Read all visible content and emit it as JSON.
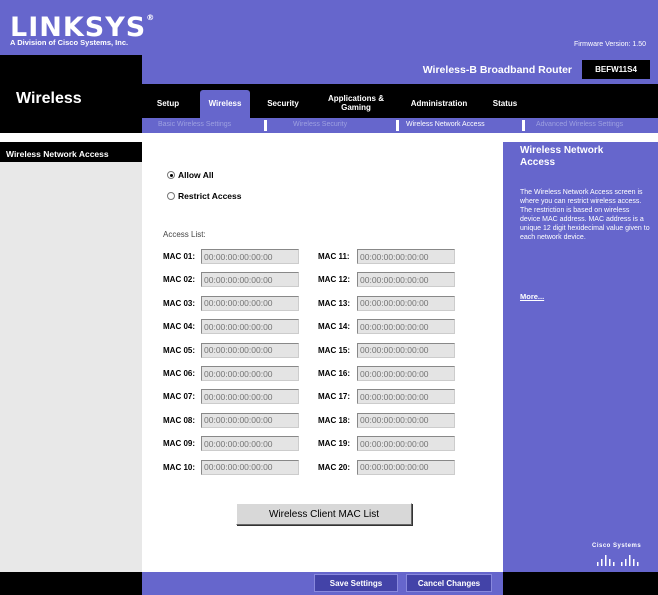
{
  "header": {
    "brand": "LINKSYS",
    "brand_mark": "®",
    "division": "A Division of Cisco Systems, Inc.",
    "firmware": "Firmware Version: 1.50",
    "product": "Wireless-B Broadband Router",
    "model": "BEFW11S4",
    "section": "Wireless"
  },
  "tabs": [
    {
      "label": "Setup",
      "active": false
    },
    {
      "label": "Wireless",
      "active": true
    },
    {
      "label": "Security",
      "active": false
    },
    {
      "label": "Applications & Gaming",
      "active": false
    },
    {
      "label": "Administration",
      "active": false
    },
    {
      "label": "Status",
      "active": false
    }
  ],
  "subtabs": [
    {
      "label": "Basic Wireless Settings",
      "active": false
    },
    {
      "label": "Wireless Security",
      "active": false
    },
    {
      "label": "Wireless Network Access",
      "active": true
    },
    {
      "label": "Advanced Wireless Settings",
      "active": false
    }
  ],
  "left_panel": {
    "title": "Wireless Network Access"
  },
  "access": {
    "allow_all": "Allow All",
    "restrict": "Restrict Access",
    "selected": "allow_all",
    "list_label": "Access List:"
  },
  "mac_placeholder": "00:00:00:00:00:00",
  "mac_labels": [
    "MAC 01:",
    "MAC 02:",
    "MAC 03:",
    "MAC 04:",
    "MAC 05:",
    "MAC 06:",
    "MAC 07:",
    "MAC 08:",
    "MAC 09:",
    "MAC 10:",
    "MAC 11:",
    "MAC 12:",
    "MAC 13:",
    "MAC 14:",
    "MAC 15:",
    "MAC 16:",
    "MAC 17:",
    "MAC 18:",
    "MAC 19:",
    "MAC 20:"
  ],
  "client_list_button": "Wireless Client MAC List",
  "help": {
    "title": "Wireless Network Access",
    "text": "The Wireless Network Access screen is where you can restrict wireless access. The restriction is based on wireless device MAC address. MAC address is a unique 12 digit hexidecimal value given to each network device.",
    "more": "More..."
  },
  "footer": {
    "save": "Save Settings",
    "cancel": "Cancel Changes",
    "vendor": "Cisco Systems"
  },
  "colors": {
    "accent": "#6666cc",
    "dark": "#000000",
    "panel": "#e8e8e8"
  }
}
